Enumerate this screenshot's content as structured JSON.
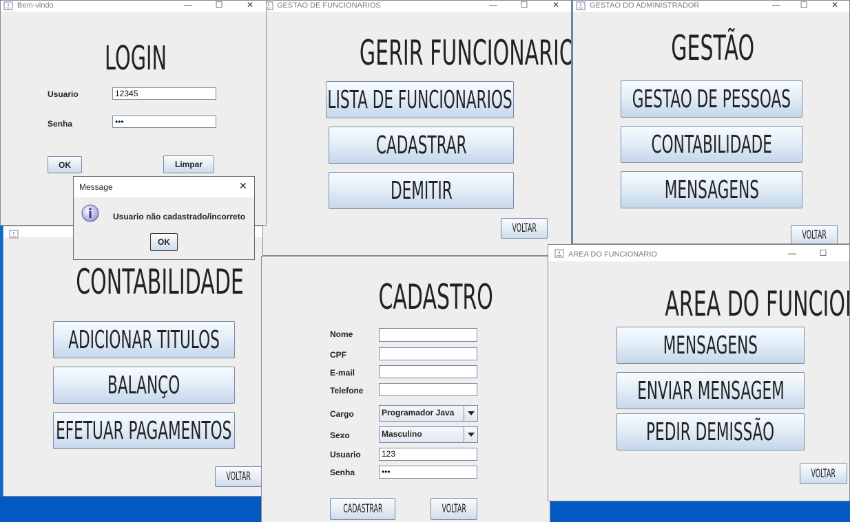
{
  "login_window": {
    "title": "Bem-vindo",
    "heading": "LOGIN",
    "usuario_label": "Usuario",
    "usuario_value": "12345",
    "senha_label": "Senha",
    "senha_value": "•••",
    "ok_label": "OK",
    "limpar_label": "Limpar"
  },
  "funcionarios_window": {
    "title": "GESTAO DE FUNCIONARIOS",
    "heading": "GERIR FUNCIONARIOS",
    "buttons": [
      "LISTA DE FUNCIONARIOS",
      "CADASTRAR",
      "DEMITIR"
    ],
    "voltar_label": "VOLTAR"
  },
  "admin_window": {
    "title": "GESTAO DO ADMINISTRADOR",
    "heading": "GESTÃO",
    "buttons": [
      "GESTAO DE PESSOAS",
      "CONTABILIDADE",
      "MENSAGENS"
    ],
    "voltar_label": "VOLTAR"
  },
  "contabilidade_window": {
    "title": "",
    "heading": "CONTABILIDADE",
    "buttons": [
      "ADICIONAR TITULOS",
      "BALANÇO",
      "EFETUAR PAGAMENTOS"
    ],
    "voltar_label": "VOLTAR"
  },
  "cadastro_window": {
    "heading": "CADASTRO",
    "fields": {
      "nome_label": "Nome",
      "cpf_label": "CPF",
      "email_label": "E-mail",
      "telefone_label": "Telefone",
      "cargo_label": "Cargo",
      "cargo_value": "Programador Java",
      "sexo_label": "Sexo",
      "sexo_value": "Masculino",
      "usuario_label": "Usuario",
      "usuario_value": "123",
      "senha_label": "Senha",
      "senha_value": "•••"
    },
    "cadastrar_label": "CADASTRAR",
    "voltar_label": "VOLTAR"
  },
  "area_window": {
    "title": "AREA DO FUNCIONARIO",
    "heading": "AREA DO FUNCIONARIO",
    "buttons": [
      "MENSAGENS",
      "ENVIAR MENSAGEM",
      "PEDIR DEMISSÃO"
    ],
    "voltar_label": "VOLTAR"
  },
  "message_dialog": {
    "title": "Message",
    "text": "Usuario não cadastrado/incorreto",
    "ok_label": "OK",
    "close_glyph": "✕"
  },
  "window_controls": {
    "minimize": "—",
    "maximize": "☐",
    "close": "✕"
  }
}
